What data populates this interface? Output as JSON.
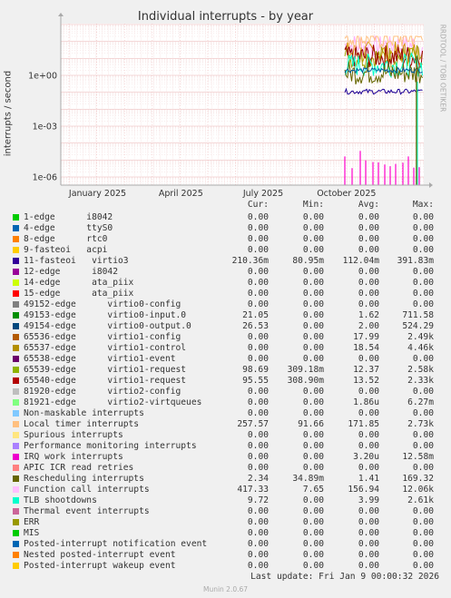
{
  "title": "Individual interrupts - by year",
  "side_label": "RRDTOOL / TOBI OETIKER",
  "chart_data": {
    "type": "line",
    "title": "Individual interrupts - by year",
    "ylabel": "interrupts / second",
    "y_scale": "log",
    "ylim": [
      3e-07,
      3000
    ],
    "y_ticks": [
      "1e+00",
      "1e-03",
      "1e-06"
    ],
    "x_ticks": [
      "January 2025",
      "April 2025",
      "July 2025",
      "October 2025"
    ],
    "grid": true,
    "series_note": "Data present only from late September 2025 to early January 2026",
    "series": [
      {
        "name": "Function call interrupts",
        "color": "#FFB0FF",
        "approx_level": 60
      },
      {
        "name": "65537-edge virtio1-control",
        "color": "#D19900",
        "approx_level": 20
      },
      {
        "name": "65539-edge virtio1-request",
        "color": "#A0A000",
        "approx_level": 12
      },
      {
        "name": "65540-edge virtio1-request",
        "color": "#990000",
        "approx_level": 13
      },
      {
        "name": "Local timer interrupts",
        "color": "#FFC080",
        "approx_level": 170
      },
      {
        "name": "TLB shootdowns",
        "color": "#00FFCC",
        "approx_level": 4
      },
      {
        "name": "Rescheduling interrupts",
        "color": "#666600",
        "approx_level": 1.4
      },
      {
        "name": "49154-edge virtio0-output.0",
        "color": "#005A9C",
        "approx_level": 2
      },
      {
        "name": "11-fasteoi virtio3",
        "color": "#1C0096",
        "approx_level": 0.11
      },
      {
        "name": "IRQ work interrupts",
        "color": "#FF00CC",
        "approx_level": 3e-06
      }
    ]
  },
  "legend": {
    "headers": [
      "Cur:",
      "Min:",
      "Avg:",
      "Max:"
    ],
    "rows": [
      {
        "label": "1-edge      i8042",
        "color": "#00CC00",
        "cur": "0.00",
        "min": "0.00",
        "avg": "0.00",
        "max": "0.00"
      },
      {
        "label": "4-edge      ttyS0",
        "color": "#0066B3",
        "cur": "0.00",
        "min": "0.00",
        "avg": "0.00",
        "max": "0.00"
      },
      {
        "label": "8-edge      rtc0",
        "color": "#FF8000",
        "cur": "0.00",
        "min": "0.00",
        "avg": "0.00",
        "max": "0.00"
      },
      {
        "label": "9-fasteoi   acpi",
        "color": "#FFCC00",
        "cur": "0.00",
        "min": "0.00",
        "avg": "0.00",
        "max": "0.00"
      },
      {
        "label": "11-fasteoi   virtio3",
        "color": "#330099",
        "cur": "210.36m",
        "min": "80.95m",
        "avg": "112.04m",
        "max": "391.83m"
      },
      {
        "label": "12-edge      i8042",
        "color": "#990099",
        "cur": "0.00",
        "min": "0.00",
        "avg": "0.00",
        "max": "0.00"
      },
      {
        "label": "14-edge      ata_piix",
        "color": "#CCFF00",
        "cur": "0.00",
        "min": "0.00",
        "avg": "0.00",
        "max": "0.00"
      },
      {
        "label": "15-edge      ata_piix",
        "color": "#FF0000",
        "cur": "0.00",
        "min": "0.00",
        "avg": "0.00",
        "max": "0.00"
      },
      {
        "label": "49152-edge      virtio0-config",
        "color": "#808080",
        "cur": "0.00",
        "min": "0.00",
        "avg": "0.00",
        "max": "0.00"
      },
      {
        "label": "49153-edge      virtio0-input.0",
        "color": "#008F00",
        "cur": "21.05",
        "min": "0.00",
        "avg": "1.62",
        "max": "711.58"
      },
      {
        "label": "49154-edge      virtio0-output.0",
        "color": "#00487D",
        "cur": "26.53",
        "min": "0.00",
        "avg": "2.00",
        "max": "524.29"
      },
      {
        "label": "65536-edge      virtio1-config",
        "color": "#B35A00",
        "cur": "0.00",
        "min": "0.00",
        "avg": "17.99",
        "max": "2.49k"
      },
      {
        "label": "65537-edge      virtio1-control",
        "color": "#B38F00",
        "cur": "0.00",
        "min": "0.00",
        "avg": "18.54",
        "max": "4.46k"
      },
      {
        "label": "65538-edge      virtio1-event",
        "color": "#6B006B",
        "cur": "0.00",
        "min": "0.00",
        "avg": "0.00",
        "max": "0.00"
      },
      {
        "label": "65539-edge      virtio1-request",
        "color": "#8FB300",
        "cur": "98.69",
        "min": "309.18m",
        "avg": "12.37",
        "max": "2.58k"
      },
      {
        "label": "65540-edge      virtio1-request",
        "color": "#B30000",
        "cur": "95.55",
        "min": "308.90m",
        "avg": "13.52",
        "max": "2.33k"
      },
      {
        "label": "81920-edge      virtio2-config",
        "color": "#BEBEBE",
        "cur": "0.00",
        "min": "0.00",
        "avg": "0.00",
        "max": "0.00"
      },
      {
        "label": "81921-edge      virtio2-virtqueues",
        "color": "#80FF80",
        "cur": "0.00",
        "min": "0.00",
        "avg": "1.86u",
        "max": "6.27m"
      },
      {
        "label": "Non-maskable interrupts",
        "color": "#80C9FF",
        "cur": "0.00",
        "min": "0.00",
        "avg": "0.00",
        "max": "0.00"
      },
      {
        "label": "Local timer interrupts",
        "color": "#FFC080",
        "cur": "257.57",
        "min": "91.66",
        "avg": "171.85",
        "max": "2.73k"
      },
      {
        "label": "Spurious interrupts",
        "color": "#FFE680",
        "cur": "0.00",
        "min": "0.00",
        "avg": "0.00",
        "max": "0.00"
      },
      {
        "label": "Performance monitoring interrupts",
        "color": "#AA80FF",
        "cur": "0.00",
        "min": "0.00",
        "avg": "0.00",
        "max": "0.00"
      },
      {
        "label": "IRQ work interrupts",
        "color": "#EE00CC",
        "cur": "0.00",
        "min": "0.00",
        "avg": "3.20u",
        "max": "12.58m"
      },
      {
        "label": "APIC ICR read retries",
        "color": "#FF8080",
        "cur": "0.00",
        "min": "0.00",
        "avg": "0.00",
        "max": "0.00"
      },
      {
        "label": "Rescheduling interrupts",
        "color": "#666600",
        "cur": "2.34",
        "min": "34.89m",
        "avg": "1.41",
        "max": "169.32"
      },
      {
        "label": "Function call interrupts",
        "color": "#FFBFFF",
        "cur": "417.33",
        "min": "7.65",
        "avg": "156.94",
        "max": "12.06k"
      },
      {
        "label": "TLB shootdowns",
        "color": "#00FFCC",
        "cur": "9.72",
        "min": "0.00",
        "avg": "3.99",
        "max": "2.61k"
      },
      {
        "label": "Thermal event interrupts",
        "color": "#CC6699",
        "cur": "0.00",
        "min": "0.00",
        "avg": "0.00",
        "max": "0.00"
      },
      {
        "label": "ERR",
        "color": "#999900",
        "cur": "0.00",
        "min": "0.00",
        "avg": "0.00",
        "max": "0.00"
      },
      {
        "label": "MIS",
        "color": "#00CC00",
        "cur": "0.00",
        "min": "0.00",
        "avg": "0.00",
        "max": "0.00"
      },
      {
        "label": "Posted-interrupt notification event",
        "color": "#0066B3",
        "cur": "0.00",
        "min": "0.00",
        "avg": "0.00",
        "max": "0.00"
      },
      {
        "label": "Nested posted-interrupt event",
        "color": "#FF8000",
        "cur": "0.00",
        "min": "0.00",
        "avg": "0.00",
        "max": "0.00"
      },
      {
        "label": "Posted-interrupt wakeup event",
        "color": "#FFCC00",
        "cur": "0.00",
        "min": "0.00",
        "avg": "0.00",
        "max": "0.00"
      }
    ]
  },
  "last_update": "Last update: Fri Jan  9 00:00:32 2026",
  "footer": "Munin 2.0.67"
}
